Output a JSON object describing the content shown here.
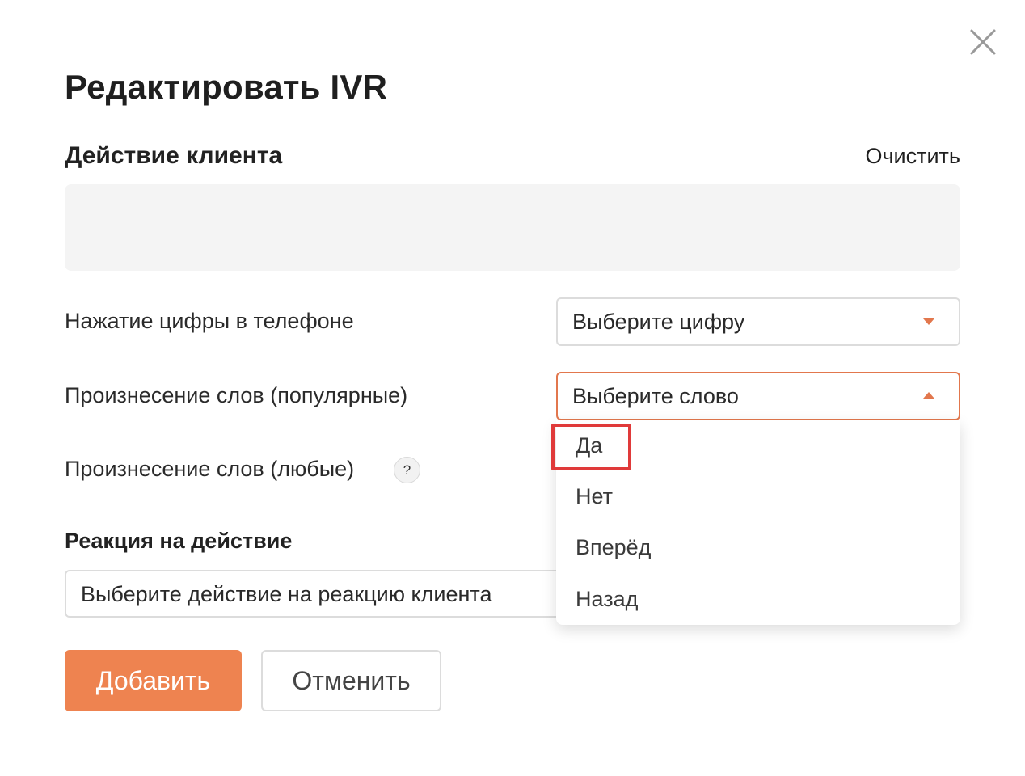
{
  "dialog": {
    "title": "Редактировать IVR",
    "close_icon": "close-icon"
  },
  "client_action": {
    "heading": "Действие клиента",
    "clear_label": "Очистить"
  },
  "digit_row": {
    "label": "Нажатие цифры в телефоне",
    "placeholder": "Выберите цифру"
  },
  "popular_words_row": {
    "label": "Произнесение слов (популярные)",
    "placeholder": "Выберите слово",
    "options": [
      "Да",
      "Нет",
      "Вперёд",
      "Назад"
    ]
  },
  "any_words_row": {
    "label": "Произнесение слов (любые)",
    "help_glyph": "?"
  },
  "reaction": {
    "heading": "Реакция на действие",
    "placeholder": "Выберите действие на реакцию клиента"
  },
  "buttons": {
    "add": "Добавить",
    "cancel": "Отменить"
  },
  "colors": {
    "accent": "#ee8350",
    "caret": "#e2774d",
    "highlight": "#e03a3a",
    "input_border": "#dcdcdc",
    "area_bg": "#f4f4f4"
  }
}
